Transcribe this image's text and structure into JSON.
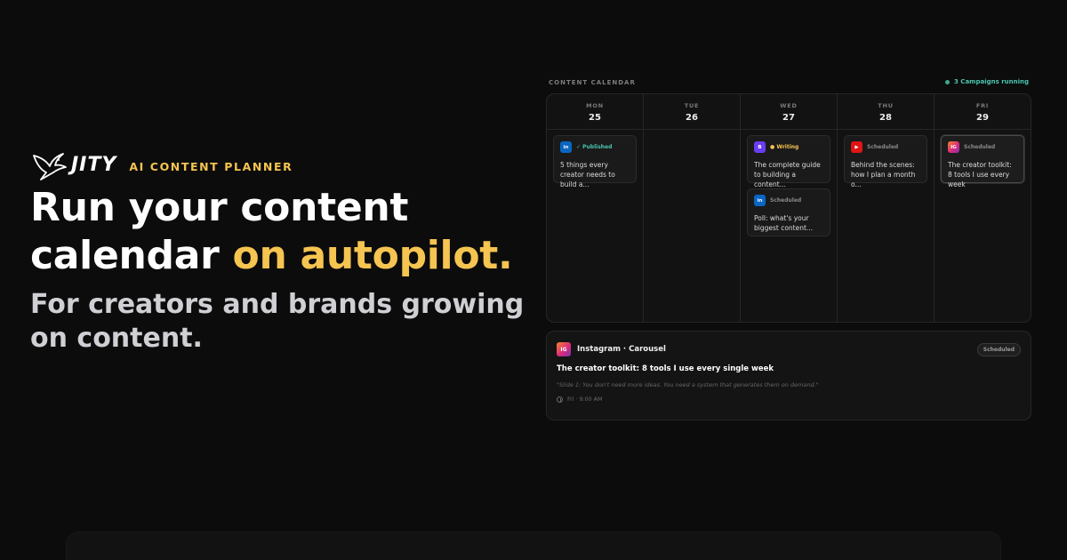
{
  "brand": {
    "wordmark": "JITY",
    "tagline": "AI CONTENT PLANNER"
  },
  "hero": {
    "headline_line1": "Run your content",
    "headline_line2_plain": "calendar ",
    "headline_line2_accent": "on autopilot.",
    "subhead": "For creators and brands growing on content."
  },
  "colors": {
    "accent": "#f5c451",
    "success": "#4ac4b0",
    "background": "#0c0c0c"
  },
  "calendar": {
    "title": "CONTENT CALENDAR",
    "campaigns": "3 Campaigns running",
    "days": [
      {
        "dow": "MON",
        "date": "25",
        "cards": [
          {
            "platform": "linkedin",
            "icon": "in",
            "status": "✓ Published",
            "status_type": "published",
            "text": "5 things every creator needs to build a..."
          }
        ]
      },
      {
        "dow": "TUE",
        "date": "26",
        "cards": []
      },
      {
        "dow": "WED",
        "date": "27",
        "cards": [
          {
            "platform": "blog",
            "icon": "B",
            "status": "● Writing",
            "status_type": "writing",
            "text": "The complete guide to building a content..."
          },
          {
            "platform": "linkedin",
            "icon": "in",
            "status": "Scheduled",
            "status_type": "scheduled",
            "text": "Poll: what's your biggest content..."
          }
        ]
      },
      {
        "dow": "THU",
        "date": "28",
        "cards": [
          {
            "platform": "youtube",
            "icon": "▶",
            "status": "Scheduled",
            "status_type": "scheduled",
            "text": "Behind the scenes: how I plan a month o..."
          }
        ]
      },
      {
        "dow": "FRI",
        "date": "29",
        "cards": [
          {
            "platform": "instagram",
            "icon": "IG",
            "status": "Scheduled",
            "status_type": "scheduled",
            "text": "The creator toolkit: 8 tools I use every week",
            "active": true
          }
        ]
      }
    ]
  },
  "detail": {
    "icon": "IG",
    "platform": "Instagram · Carousel",
    "status": "Scheduled",
    "title": "The creator toolkit: 8 tools I use every single week",
    "quote": "\"Slide 1: You don't need more ideas. You need a system that generates them on demand.\"",
    "time": "Fri · 9:00 AM"
  }
}
